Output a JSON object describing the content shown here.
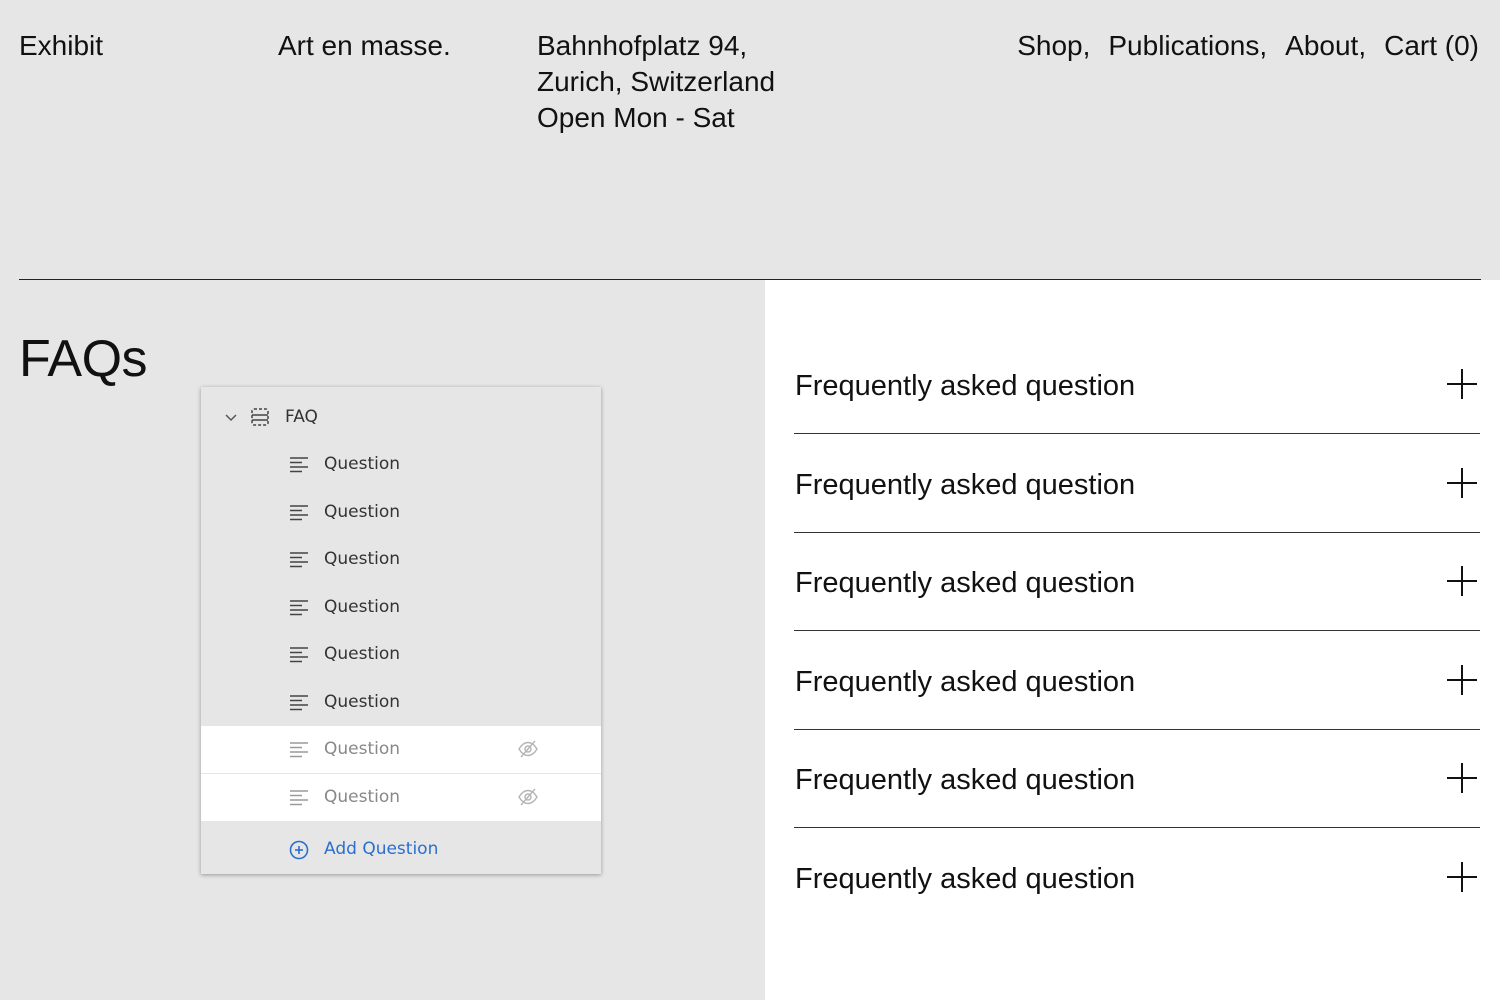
{
  "header": {
    "brand": "Exhibit",
    "tagline": "Art en masse.",
    "address_lines": [
      "Bahnhofplatz 94,",
      "Zurich, Switzerland",
      "Open Mon - Sat"
    ]
  },
  "nav": {
    "shop": "Shop,",
    "publications": "Publications,",
    "about": "About,",
    "cart": "Cart (0)"
  },
  "page_title": "FAQs",
  "editor_panel": {
    "root_label": "FAQ",
    "items": [
      {
        "label": "Question",
        "hidden": false
      },
      {
        "label": "Question",
        "hidden": false
      },
      {
        "label": "Question",
        "hidden": false
      },
      {
        "label": "Question",
        "hidden": false
      },
      {
        "label": "Question",
        "hidden": false
      },
      {
        "label": "Question",
        "hidden": false
      },
      {
        "label": "Question",
        "hidden": true
      },
      {
        "label": "Question",
        "hidden": true
      }
    ],
    "add_label": "Add Question"
  },
  "faqs": [
    {
      "question": "Frequently asked question"
    },
    {
      "question": "Frequently asked question"
    },
    {
      "question": "Frequently asked question"
    },
    {
      "question": "Frequently asked question"
    },
    {
      "question": "Frequently asked question"
    },
    {
      "question": "Frequently asked question"
    }
  ],
  "colors": {
    "background": "#e6e6e6",
    "panel_hidden_row": "#ffffff",
    "accent_blue": "#2a6fd0",
    "text": "#111111"
  }
}
